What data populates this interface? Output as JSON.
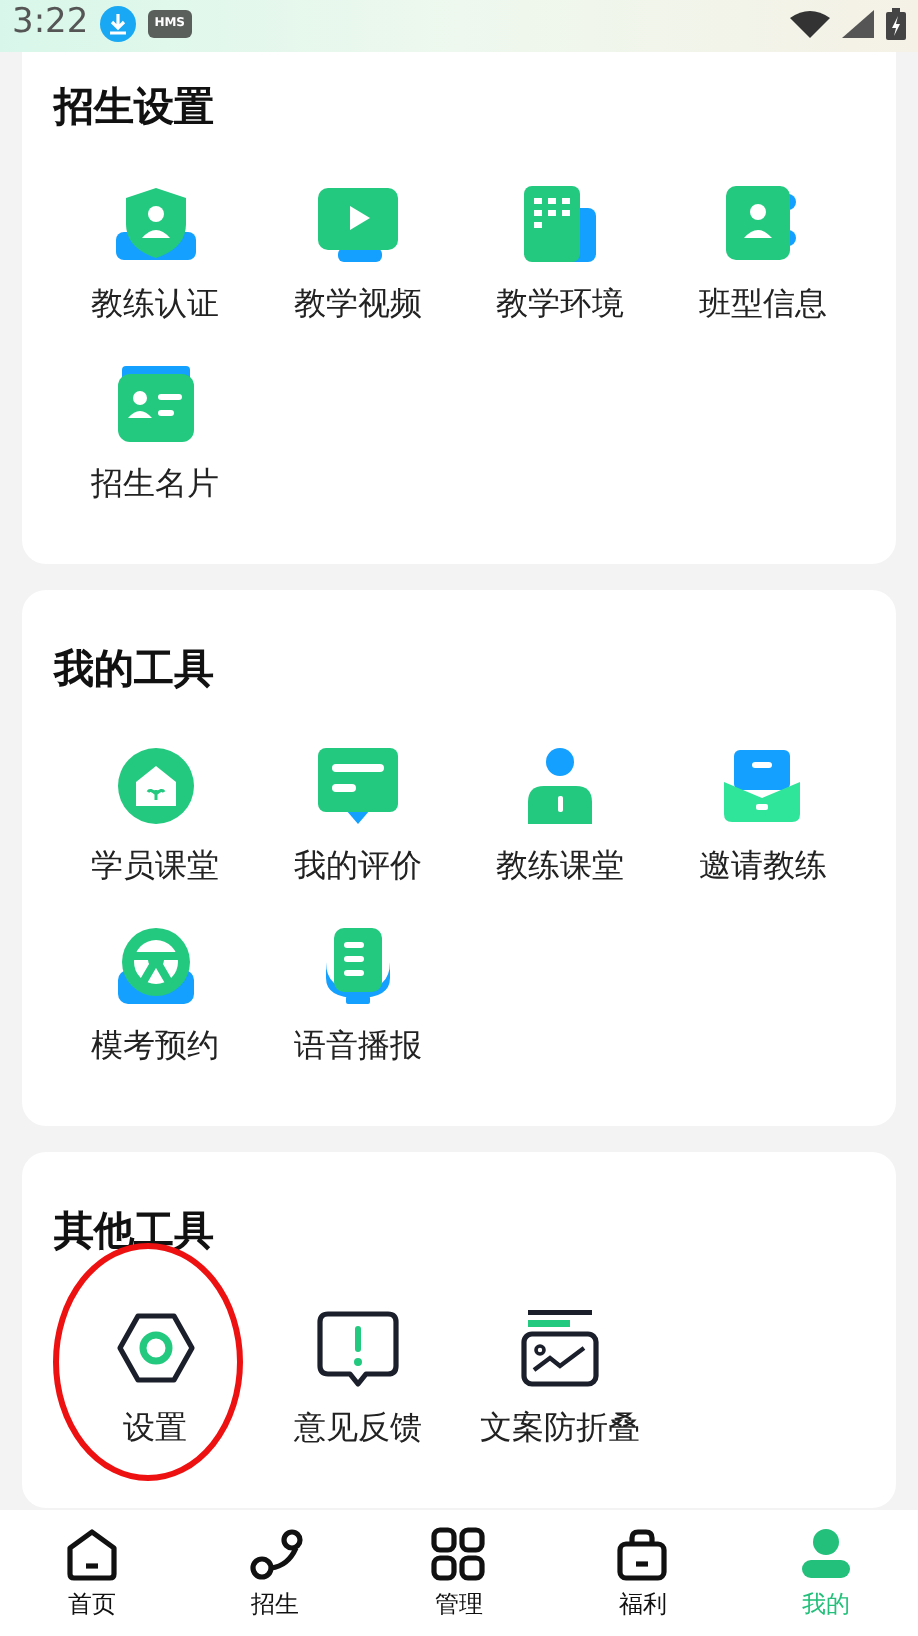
{
  "status_bar": {
    "time": "3:22",
    "badge": "HMS"
  },
  "sections": [
    {
      "title": "招生设置",
      "items": [
        {
          "label": "教练认证"
        },
        {
          "label": "教学视频"
        },
        {
          "label": "教学环境"
        },
        {
          "label": "班型信息"
        },
        {
          "label": "招生名片"
        }
      ]
    },
    {
      "title": "我的工具",
      "items": [
        {
          "label": "学员课堂"
        },
        {
          "label": "我的评价"
        },
        {
          "label": "教练课堂"
        },
        {
          "label": "邀请教练"
        },
        {
          "label": "模考预约"
        },
        {
          "label": "语音播报"
        }
      ]
    },
    {
      "title": "其他工具",
      "items": [
        {
          "label": "设置",
          "highlighted": true
        },
        {
          "label": "意见反馈",
          "highlighted": false
        },
        {
          "label": "文案防折叠",
          "highlighted": false
        }
      ]
    }
  ],
  "tab_bar": [
    {
      "label": "首页",
      "selected": false
    },
    {
      "label": "招生",
      "selected": false
    },
    {
      "label": "管理",
      "selected": false
    },
    {
      "label": "福利",
      "selected": false
    },
    {
      "label": "我的",
      "selected": true
    }
  ]
}
